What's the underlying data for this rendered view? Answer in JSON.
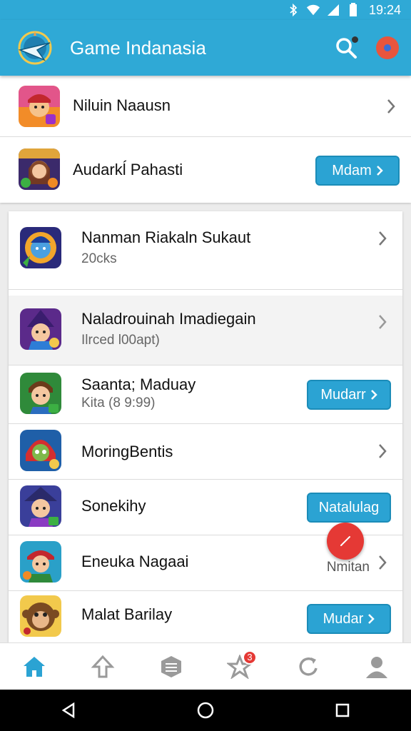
{
  "status_bar": {
    "time": "19:24",
    "icons": [
      "bluetooth-icon",
      "wifi-icon",
      "signal-icon",
      "battery-icon"
    ]
  },
  "app_bar": {
    "title": "Game Indanasia",
    "logo": "compass-logo-icon",
    "actions": [
      "search-icon",
      "record-icon"
    ]
  },
  "colors": {
    "primary": "#2fa9d6",
    "button": "#2ba3d3",
    "fab": "#e53935",
    "badge": "#e53935"
  },
  "top_list": [
    {
      "title": "Niluin Naausn",
      "action": "chevron"
    },
    {
      "title": "Audarkĺ Pahasti",
      "action": "button",
      "button_label": "Mdam"
    }
  ],
  "main_list": [
    {
      "title": "Nanman Riakaln Sukaut",
      "subtitle": "20cks",
      "action": "chevron"
    },
    {
      "title": "Naladrouinah Imadiegain",
      "subtitle": "Ilrced l00apt)",
      "action": "chevron",
      "highlighted": true
    },
    {
      "title": "Saanta; Maduay",
      "subtitle": "Kita (8 9:99)",
      "action": "button",
      "button_label": "Mudarr"
    },
    {
      "title": "MoringBentis",
      "action": "chevron"
    },
    {
      "title": "Sonekihy",
      "action": "button",
      "button_label": "Natalulag"
    },
    {
      "title": "Eneuka Nagaai",
      "action": "chevron",
      "side_label": "Nmitan"
    },
    {
      "title": "Malat Barilay",
      "action": "button",
      "button_label": "Mudar"
    }
  ],
  "fab": {
    "icon": "edit-icon"
  },
  "bottom_nav": [
    {
      "icon": "home-icon",
      "active": true
    },
    {
      "icon": "rocket-icon"
    },
    {
      "icon": "layers-icon"
    },
    {
      "icon": "star-icon",
      "badge": "3"
    },
    {
      "icon": "refresh-icon"
    },
    {
      "icon": "profile-icon"
    }
  ],
  "system_nav": [
    "back-icon",
    "home-circle-icon",
    "recents-icon"
  ]
}
